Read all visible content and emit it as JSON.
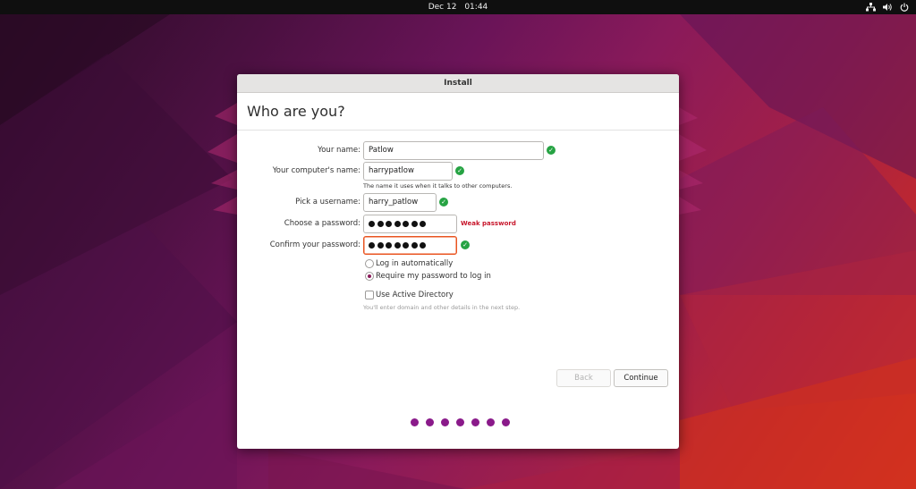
{
  "topbar": {
    "date": "Dec 12",
    "time": "01:44",
    "icons": [
      "network-icon",
      "volume-icon",
      "power-icon"
    ]
  },
  "window": {
    "title": "Install",
    "heading": "Who are you?"
  },
  "form": {
    "name_label": "Your name:",
    "name_value": "Patlow",
    "computer_label": "Your computer's name:",
    "computer_value": "harrypatlow",
    "computer_hint": "The name it uses when it talks to other computers.",
    "username_label": "Pick a username:",
    "username_value": "harry_patlow",
    "password_label": "Choose a password:",
    "password_masked_length": 7,
    "password_strength": "Weak password",
    "confirm_label": "Confirm your password:",
    "confirm_masked_length": 7,
    "login_auto_label": "Log in automatically",
    "login_require_label": "Require my password to log in",
    "login_selected": "require",
    "active_directory_label": "Use Active Directory",
    "active_directory_checked": false,
    "active_directory_hint": "You'll enter domain and other details in the next step."
  },
  "buttons": {
    "back": "Back",
    "continue": "Continue"
  },
  "progress": {
    "steps": 7
  },
  "colors": {
    "accent": "#e95420",
    "valid": "#26a343",
    "warning": "#c7162b",
    "progress": "#8a1a8a"
  }
}
